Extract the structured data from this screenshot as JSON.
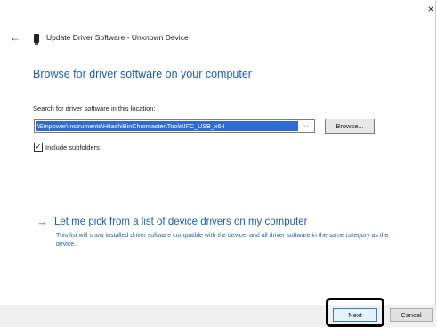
{
  "window": {
    "title": "Update Driver Software - Unknown Device",
    "close_glyph": "×",
    "back_glyph": "←"
  },
  "main": {
    "heading": "Browse for driver software on your computer",
    "search_label": "Search for driver software in this location:",
    "path_value": "\\Empower\\Instruments\\HitachiBinChromaster\\Tools\\IFC_USB_x64",
    "browse_label": "Browse...",
    "include_subfolders_label": "Include subfolders",
    "include_subfolders_checked": true,
    "checkbox_glyph": "✓",
    "pick_link_arrow": "→",
    "pick_link_text": "Let me pick from a list of device drivers on my computer",
    "pick_description": "This list will show installed driver software compatible with the device, and all driver software in the same category as the device."
  },
  "footer": {
    "next_label": "Next",
    "cancel_label": "Cancel"
  },
  "colors": {
    "accent": "#1f5fa8",
    "selection": "#2f6bd0",
    "highlight_frame": "#000000"
  },
  "icons": {
    "close": "close-icon",
    "back": "back-arrow-icon",
    "device": "device-icon",
    "dropdown": "chevron-down-icon",
    "link_arrow": "arrow-right-icon"
  }
}
